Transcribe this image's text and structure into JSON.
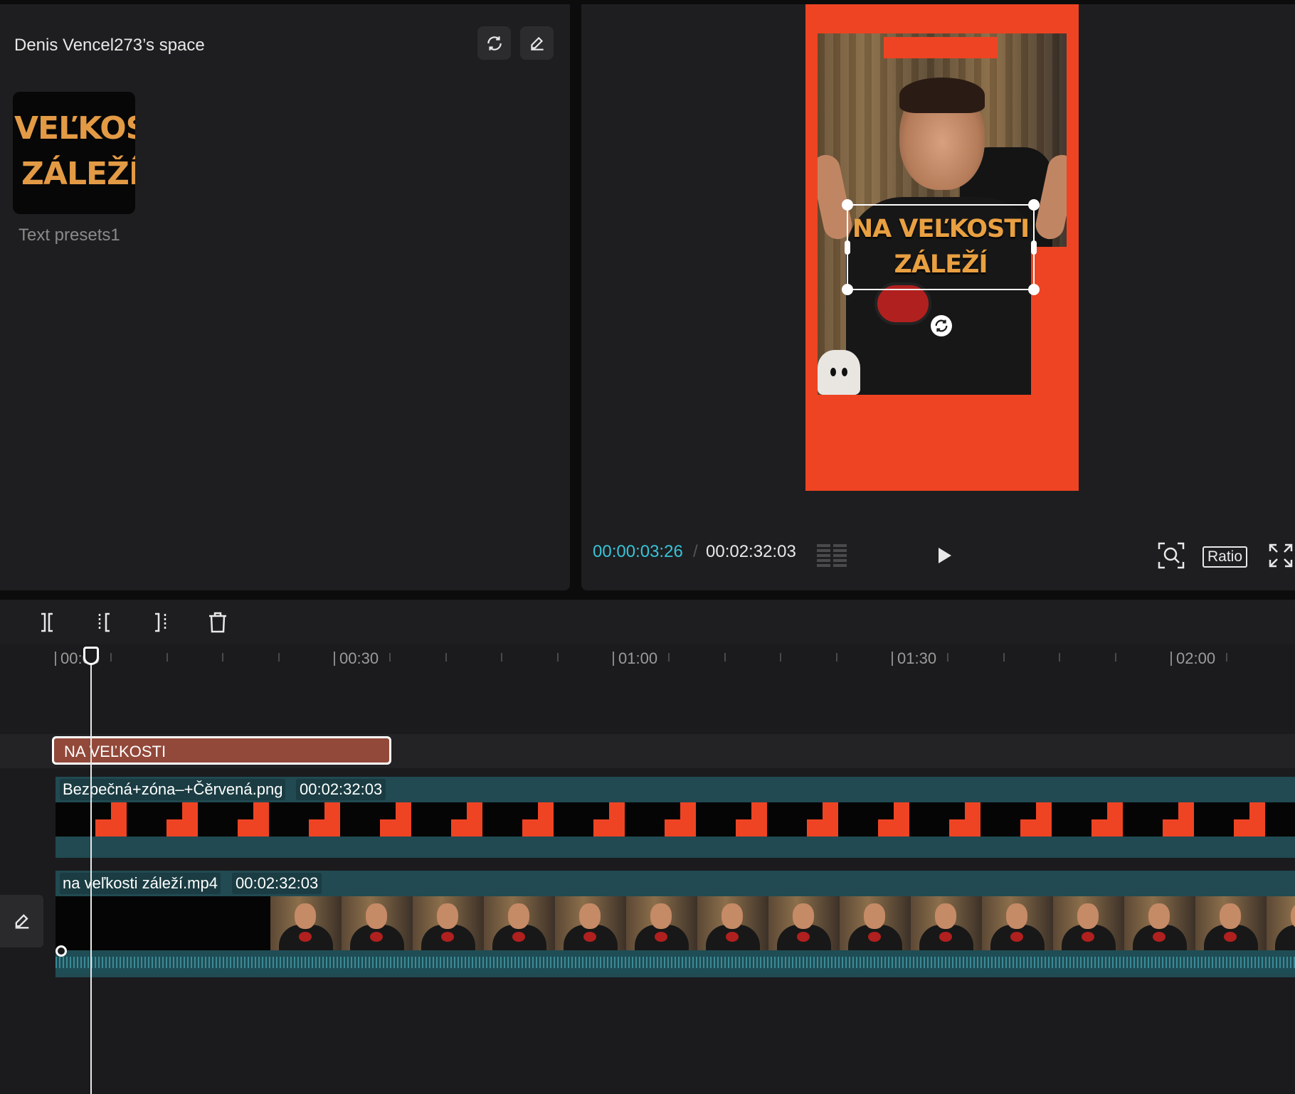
{
  "left_panel": {
    "title": "Denis Vencel273’s space",
    "preset": {
      "thumb_line1": "VEĽKOS",
      "thumb_line2": "ZÁLEŽÍ",
      "label": "Text presets1"
    }
  },
  "preview": {
    "selected_text_line1": "NA VEĽKOSTI",
    "selected_text_line2": "ZÁLEŽÍ",
    "current_time": "00:00:03:26",
    "separator": "/",
    "total_time": "00:02:32:03",
    "ratio_label": "Ratio"
  },
  "timeline": {
    "ruler": [
      "00:00",
      "00:30",
      "01:00",
      "01:30",
      "02:00"
    ],
    "text_clip": {
      "label": "NA VEĽKOSTI"
    },
    "image_clip": {
      "name": "Bezpečná+zóna–+Čěrvená.png",
      "duration": "00:02:32:03"
    },
    "video_clip": {
      "name": "na veľkosti záleží.mp4",
      "duration": "00:02:32:03"
    }
  },
  "colors": {
    "accent_time": "#38c3d8",
    "canvas_red": "#ee4423",
    "text_clip": "#92493a",
    "media_clip": "#214a52",
    "title_text": "#e9a041"
  }
}
